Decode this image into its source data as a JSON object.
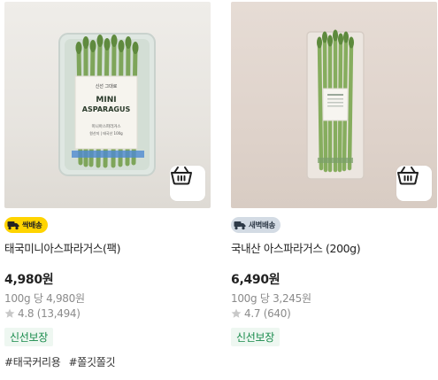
{
  "products": [
    {
      "badge": "싹배송",
      "title": "태국미니아스파라거스(팩)",
      "price": "4,980원",
      "unit_price": "100g 당 4,980원",
      "rating": "4.8 (13,494)",
      "tag": "신선보장",
      "hashtags": [
        "#태국커리용",
        "#쫄깃쫄깃"
      ],
      "package_label": {
        "brand": "신선 그대로",
        "line1": "MINI",
        "line2": "ASPARAGUS",
        "sub1": "미니아스파라거스",
        "sub2": "원산지 | 태국산 100g"
      }
    },
    {
      "badge": "새벽배송",
      "title": "국내산 아스파라거스 (200g)",
      "price": "6,490원",
      "unit_price": "100g 당 3,245원",
      "rating": "4.7 (640)",
      "tag": "신선보장",
      "hashtags": []
    }
  ],
  "icons": {
    "cart": "basket-icon",
    "rating": "star-icon",
    "badge_1": "truck-icon",
    "badge_2": "delivery-truck-icon"
  },
  "colors": {
    "badge_yellow": "#ffd400",
    "badge_gray": "#d3dbe4",
    "fresh_tag": "#178a4a"
  }
}
